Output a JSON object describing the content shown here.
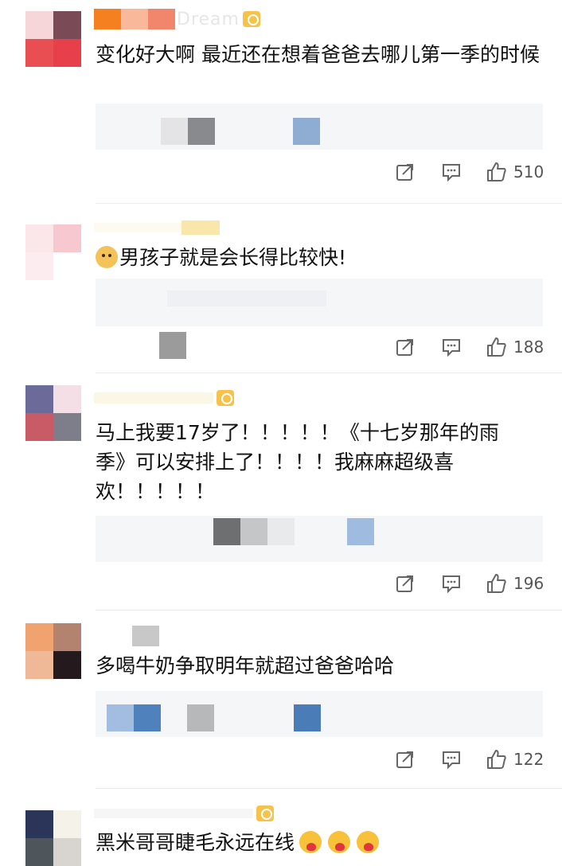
{
  "comments": [
    {
      "username_ghost": "Dream",
      "text": "变化好大啊 最近还在想着爸爸去哪儿第一季的时候",
      "likes": "510",
      "avatar_colors": [
        "#f6d6d9",
        "#7a4a57",
        "#e94f52",
        "#e8404a"
      ]
    },
    {
      "username_ghost": "",
      "text": "男孩子就是会长得比较快!",
      "likes": "188",
      "avatar_colors": [
        "#fbe7ea",
        "#f7c8cf",
        "#fcecef",
        "#ffffff"
      ]
    },
    {
      "username_ghost": "",
      "text": "马上我要17岁了！！！！！《十七岁那年的雨季》可以安排上了！！！！我麻麻超级喜欢！！！！！",
      "likes": "196",
      "avatar_colors": [
        "#6c6a99",
        "#f4dfe6",
        "#c95b67",
        "#7e7d8a"
      ]
    },
    {
      "username_ghost": "",
      "text": "多喝牛奶争取明年就超过爸爸哈哈",
      "likes": "122",
      "avatar_colors": [
        "#f0a36f",
        "#b48370",
        "#efb998",
        "#241a1e"
      ]
    },
    {
      "username_ghost": "",
      "text": "黑米哥哥睫毛永远在线",
      "likes": "",
      "avatar_colors": [
        "#2a3558",
        "#f5f2ea",
        "#4e565c",
        "#d8d4cf"
      ]
    }
  ],
  "icons": {
    "repost": "repost-icon",
    "comment": "comment-icon",
    "like": "like-icon"
  },
  "colors": {
    "reply_bg": "#f5f6f8",
    "icon_gray": "#666666"
  }
}
